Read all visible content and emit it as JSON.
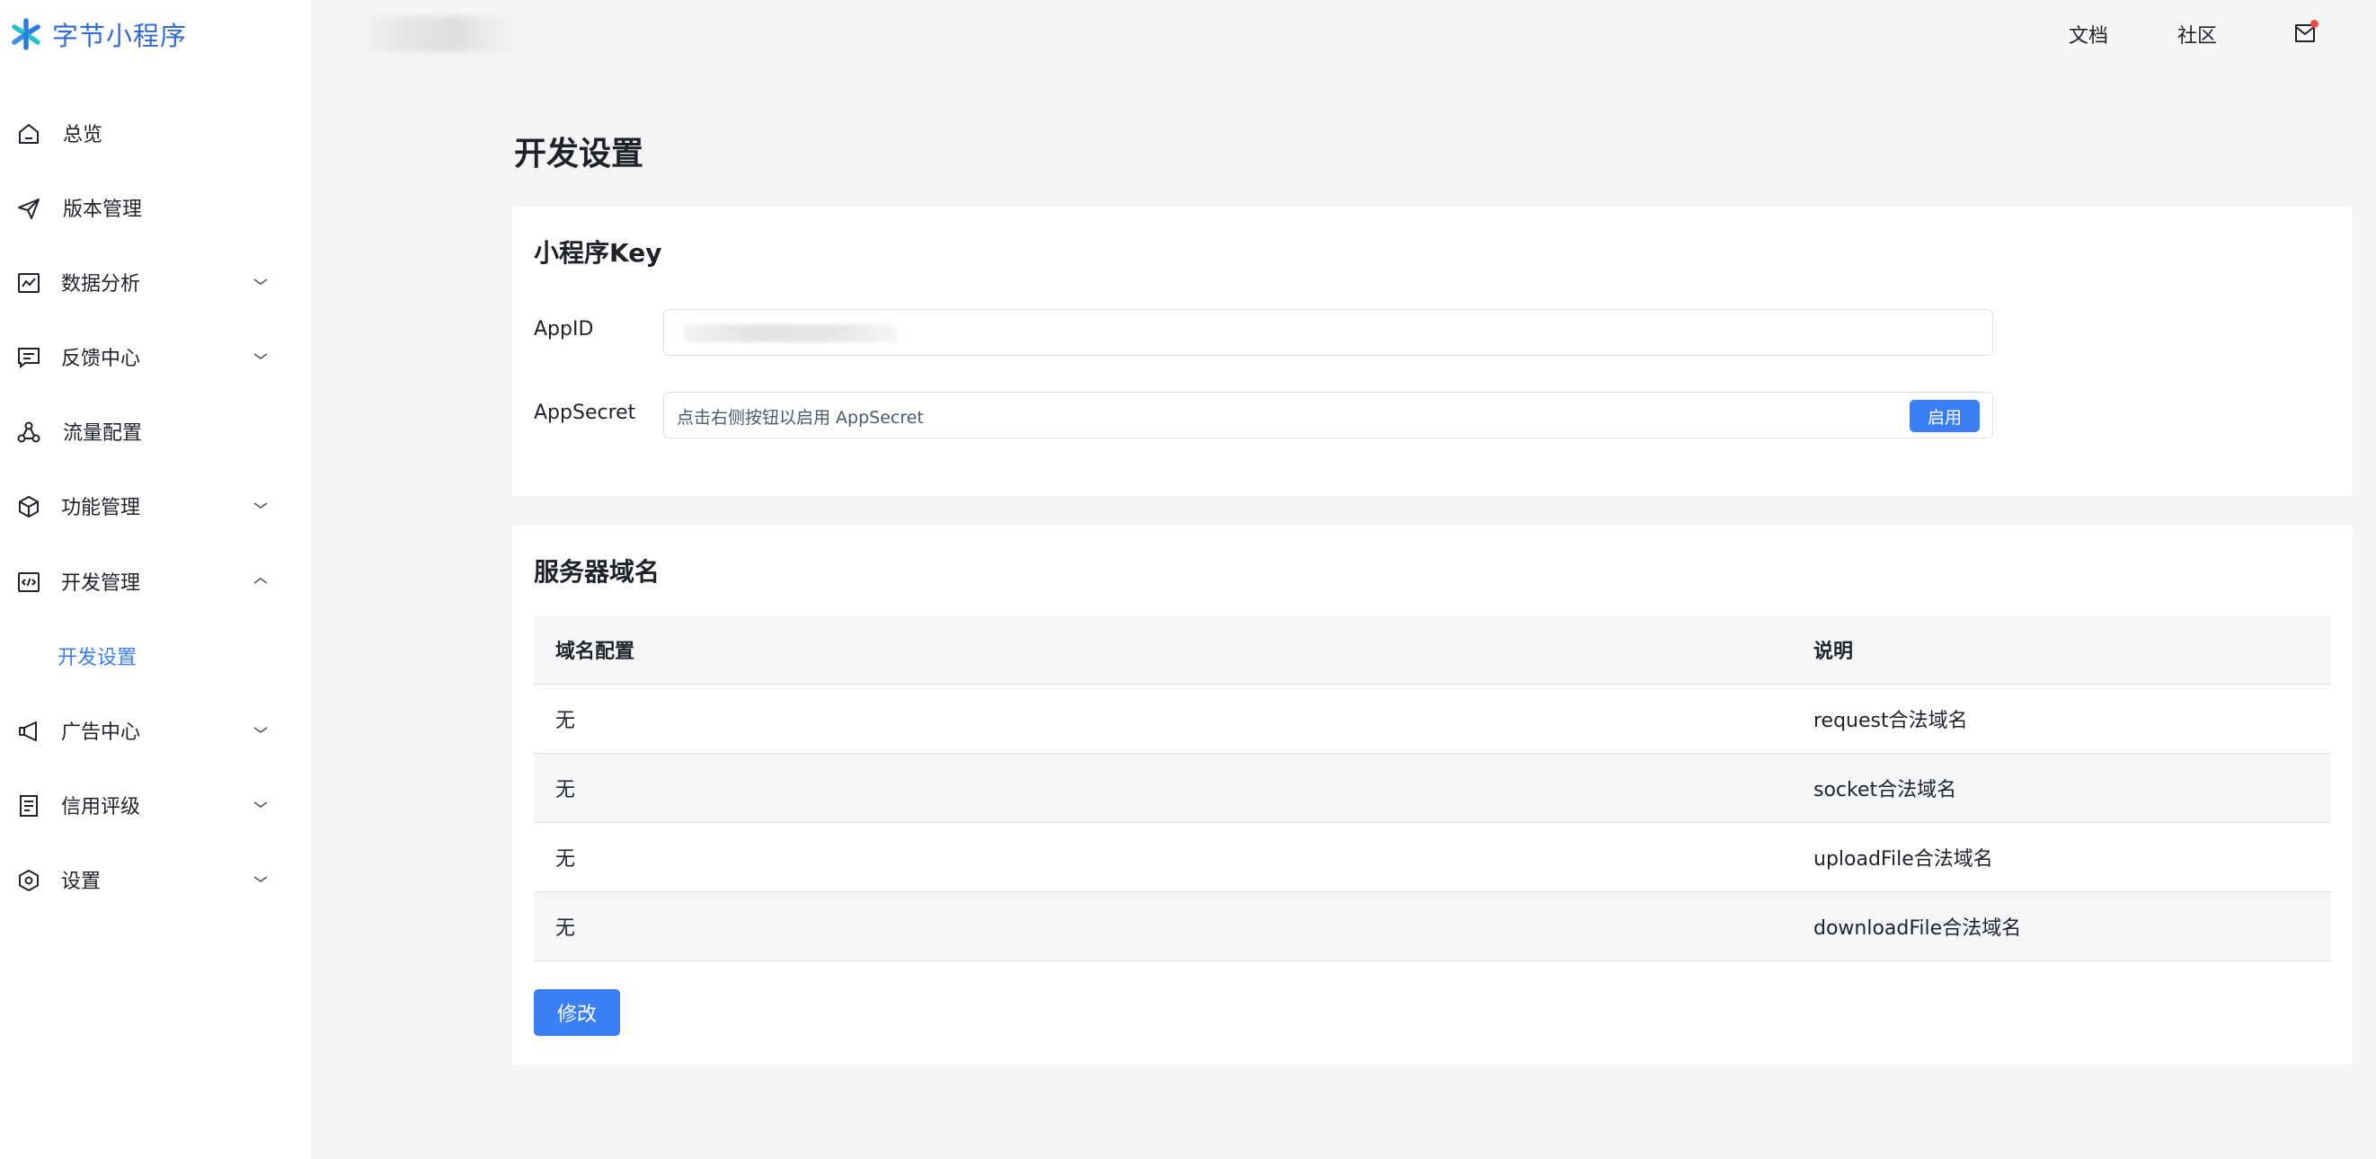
{
  "app": {
    "logo_text": "字节小程序"
  },
  "header": {
    "links": [
      "文档",
      "社区"
    ]
  },
  "sidebar": {
    "items": [
      {
        "label": "总览",
        "icon": "home-icon"
      },
      {
        "label": "版本管理",
        "icon": "send-icon"
      },
      {
        "label": "数据分析",
        "icon": "chart-icon",
        "expandable": true
      },
      {
        "label": "反馈中心",
        "icon": "message-icon",
        "expandable": true
      },
      {
        "label": "流量配置",
        "icon": "network-icon"
      },
      {
        "label": "功能管理",
        "icon": "cube-icon",
        "expandable": true
      },
      {
        "label": "开发管理",
        "icon": "code-icon",
        "expanded": true,
        "children": [
          {
            "label": "开发设置",
            "active": true
          }
        ]
      },
      {
        "label": "广告中心",
        "icon": "megaphone-icon",
        "expandable": true
      },
      {
        "label": "信用评级",
        "icon": "document-icon",
        "expandable": true
      },
      {
        "label": "设置",
        "icon": "settings-icon",
        "expandable": true
      }
    ]
  },
  "main": {
    "title": "开发设置",
    "key_card": {
      "title": "小程序Key",
      "appid_label": "AppID",
      "appsecret_label": "AppSecret",
      "appsecret_value": "点击右侧按钮以启用 AppSecret",
      "enable_button": "启用"
    },
    "domain_card": {
      "title": "服务器域名",
      "columns": [
        "域名配置",
        "说明"
      ],
      "rows": [
        [
          "无",
          "request合法域名"
        ],
        [
          "无",
          "socket合法域名"
        ],
        [
          "无",
          "uploadFile合法域名"
        ],
        [
          "无",
          "downloadFile合法域名"
        ]
      ],
      "modify_button": "修改"
    }
  },
  "colors": {
    "accent": "#3b7ff4",
    "logo": "#2f6bd8",
    "badge": "#f54a45"
  }
}
